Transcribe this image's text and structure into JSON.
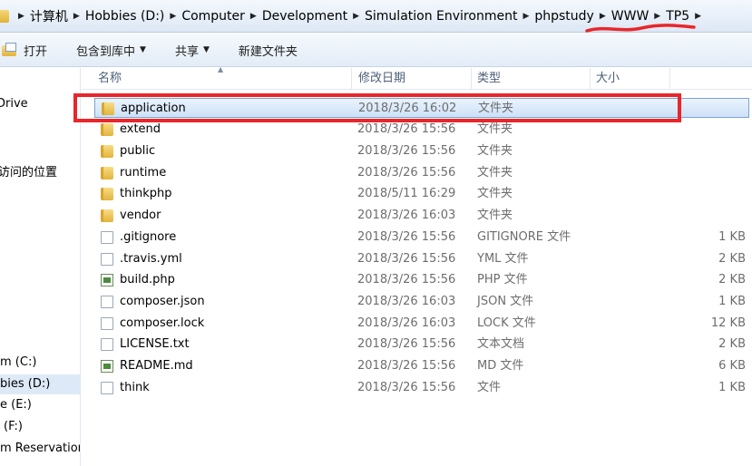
{
  "address_bar": {
    "crumbs": [
      "计算机",
      "Hobbies (D:)",
      "Computer",
      "Development",
      "Simulation Environment",
      "phpstudy",
      "WWW",
      "TP5"
    ]
  },
  "toolbar": {
    "open_label": "打开",
    "include_label": "包含到库中",
    "share_label": "共享",
    "new_folder_label": "新建文件夹"
  },
  "nav": {
    "items": [
      "Drive",
      "访问的位置",
      "m (C:)",
      "bies (D:)",
      "e (E:)",
      "(F:)",
      "m Reservation"
    ],
    "selected_index": 3
  },
  "columns": {
    "name": "名称",
    "date": "修改日期",
    "type": "类型",
    "size": "大小"
  },
  "files": [
    {
      "name": "application",
      "date": "2018/3/26 16:02",
      "type": "文件夹",
      "size": "",
      "icon": "folder-icon"
    },
    {
      "name": "extend",
      "date": "2018/3/26 15:56",
      "type": "文件夹",
      "size": "",
      "icon": "folder-icon"
    },
    {
      "name": "public",
      "date": "2018/3/26 15:56",
      "type": "文件夹",
      "size": "",
      "icon": "folder-icon"
    },
    {
      "name": "runtime",
      "date": "2018/3/26 15:56",
      "type": "文件夹",
      "size": "",
      "icon": "folder-icon"
    },
    {
      "name": "thinkphp",
      "date": "2018/5/11 16:29",
      "type": "文件夹",
      "size": "",
      "icon": "folder-icon"
    },
    {
      "name": "vendor",
      "date": "2018/3/26 16:03",
      "type": "文件夹",
      "size": "",
      "icon": "folder-icon"
    },
    {
      "name": ".gitignore",
      "date": "2018/3/26 15:56",
      "type": "GITIGNORE 文件",
      "size": "1 KB",
      "icon": "file-icon"
    },
    {
      "name": ".travis.yml",
      "date": "2018/3/26 15:56",
      "type": "YML 文件",
      "size": "2 KB",
      "icon": "file-icon"
    },
    {
      "name": "build.php",
      "date": "2018/3/26 15:56",
      "type": "PHP 文件",
      "size": "2 KB",
      "icon": "php-file-icon"
    },
    {
      "name": "composer.json",
      "date": "2018/3/26 16:03",
      "type": "JSON 文件",
      "size": "1 KB",
      "icon": "file-icon"
    },
    {
      "name": "composer.lock",
      "date": "2018/3/26 16:03",
      "type": "LOCK 文件",
      "size": "12 KB",
      "icon": "file-icon"
    },
    {
      "name": "LICENSE.txt",
      "date": "2018/3/26 15:56",
      "type": "文本文档",
      "size": "2 KB",
      "icon": "text-file-icon"
    },
    {
      "name": "README.md",
      "date": "2018/3/26 15:56",
      "type": "MD 文件",
      "size": "6 KB",
      "icon": "md-file-icon"
    },
    {
      "name": "think",
      "date": "2018/3/26 15:56",
      "type": "文件",
      "size": "1 KB",
      "icon": "file-icon"
    }
  ],
  "selected_row": 0,
  "colors": {
    "highlight_box": "#e8262b",
    "scribble": "#e8262b",
    "selection": "#cde1f7"
  }
}
